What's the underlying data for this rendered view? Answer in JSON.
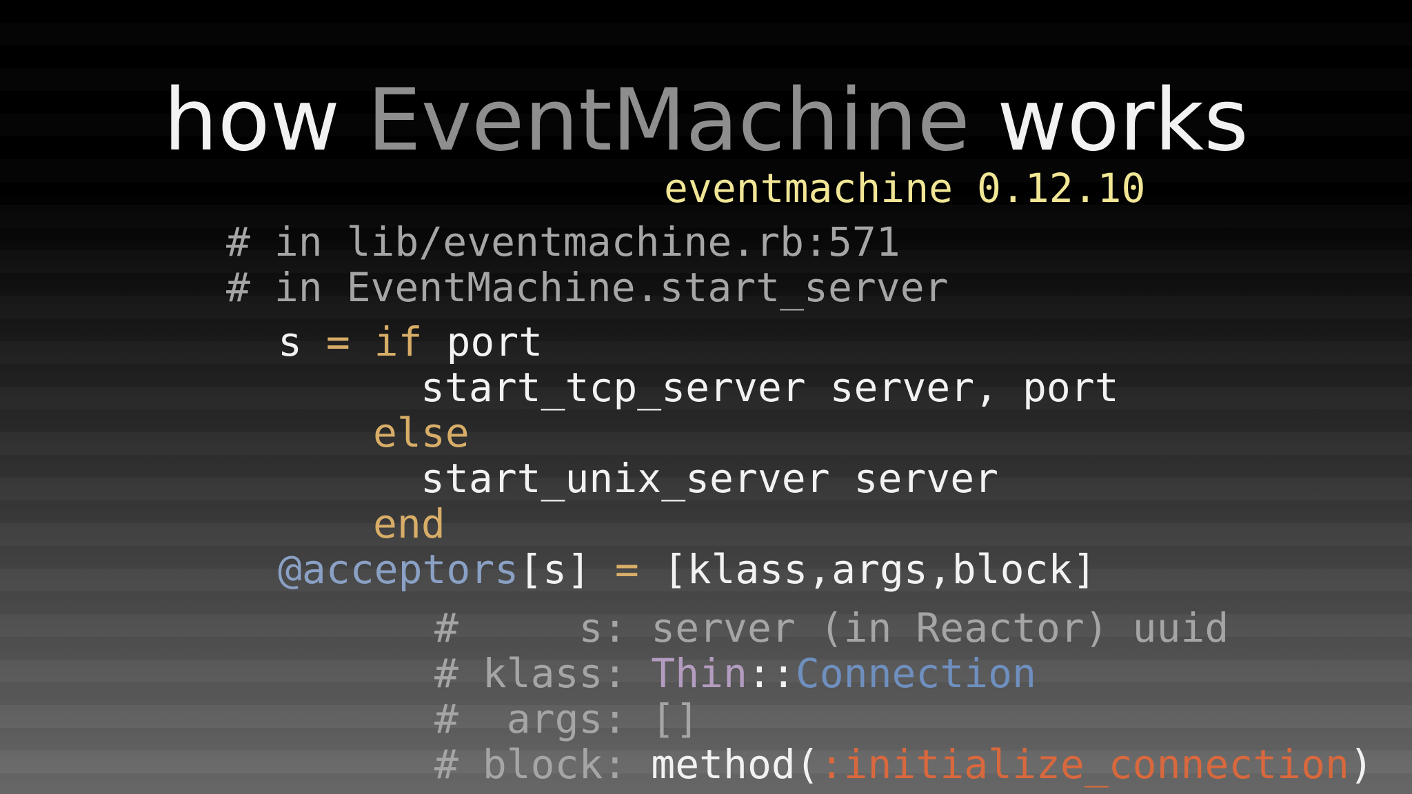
{
  "slide": {
    "title_part1": "how ",
    "title_part2": "EventMachine",
    "title_part3": " works",
    "version": "eventmachine 0.12.10"
  },
  "code": {
    "comment1": "# in lib/eventmachine.rb:571",
    "comment2": "# in EventMachine.start_server",
    "line3": {
      "a": "s ",
      "b": "= if",
      "c": " port"
    },
    "line4": "start_tcp_server server, port",
    "line5": "else",
    "line6": "start_unix_server server",
    "line7": "end",
    "line8": {
      "a": "@acceptors",
      "b": "[s] ",
      "c": "=",
      "d": " [klass,args,block]"
    },
    "note1": {
      "a": "#     s: ",
      "b": "server (in Reactor) uuid"
    },
    "note2": {
      "a": "# klass: ",
      "b": "Thin",
      "c": "::",
      "d": "Connection"
    },
    "note3": {
      "a": "#  args: ",
      "b": "[]"
    },
    "note4": {
      "a": "# block: ",
      "b": "method(",
      "c": ":initialize_connection",
      "d": ")"
    }
  },
  "colors": {
    "comment": "#a5a5a5",
    "keyword": "#d7ad68",
    "ivar": "#8aa0c4",
    "symbol": "#d8683d",
    "version": "#f1e696"
  }
}
